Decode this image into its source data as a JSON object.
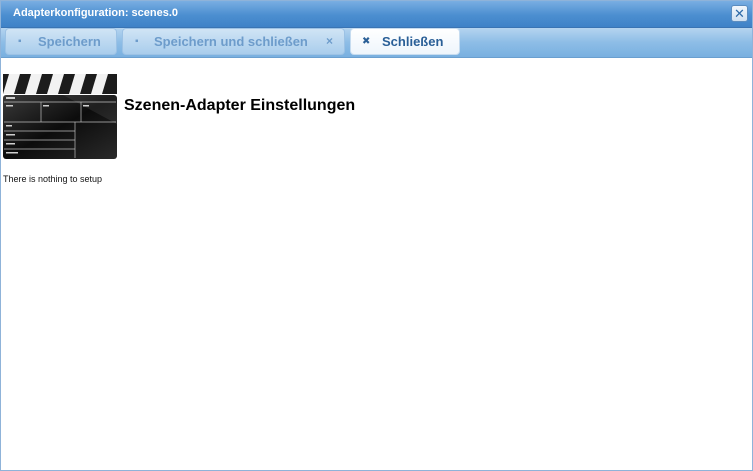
{
  "window": {
    "title": "Adapterkonfiguration: scenes.0",
    "close_glyph": "✕"
  },
  "toolbar": {
    "buttons": [
      {
        "label": "Speichern",
        "icon": "save-icon",
        "glyph": "▪"
      },
      {
        "label": "Speichern und schließen",
        "icon": "save-icon",
        "glyph": "▪",
        "trailing_glyph": "×"
      },
      {
        "label": "Schließen",
        "icon": "close-icon",
        "glyph": "✖"
      }
    ]
  },
  "content": {
    "logo_icon": "clapperboard-icon",
    "heading": "Szenen-Adapter Einstellungen",
    "message": "There is nothing to setup"
  },
  "colors": {
    "titlebar": "#4b8ed0",
    "toolbar": "#8dbde6",
    "active_button_text": "#2a5f97",
    "inactive_button_text": "#6d9ccb"
  }
}
